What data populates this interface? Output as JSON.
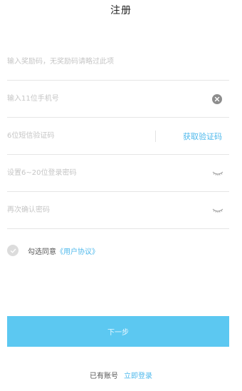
{
  "header": {
    "title": "注册"
  },
  "form": {
    "reward_code": {
      "value": "",
      "placeholder": "输入奖励码，无奖励码请略过此项"
    },
    "phone": {
      "value": "",
      "placeholder": "输入11位手机号",
      "clear_icon": "clear-circle-icon"
    },
    "sms_code": {
      "value": "",
      "placeholder": "6位短信验证码",
      "get_code_label": "获取验证码"
    },
    "password": {
      "value": "",
      "placeholder": "设置6~20位登录密码",
      "toggle_icon": "eye-closed-icon"
    },
    "confirm_password": {
      "value": "",
      "placeholder": "再次确认密码",
      "toggle_icon": "eye-closed-icon"
    }
  },
  "agreement": {
    "checked": false,
    "check_icon": "check-circle-icon",
    "text": "勾选同意",
    "link": "《用户协议》"
  },
  "actions": {
    "next_label": "下一步"
  },
  "footer": {
    "prompt": "已有账号",
    "login_link": "立即登录"
  },
  "colors": {
    "accent": "#4fb9ec",
    "button_bg": "#5cc8f1",
    "divider": "#e6e6e6",
    "placeholder": "#c6c6c6"
  }
}
